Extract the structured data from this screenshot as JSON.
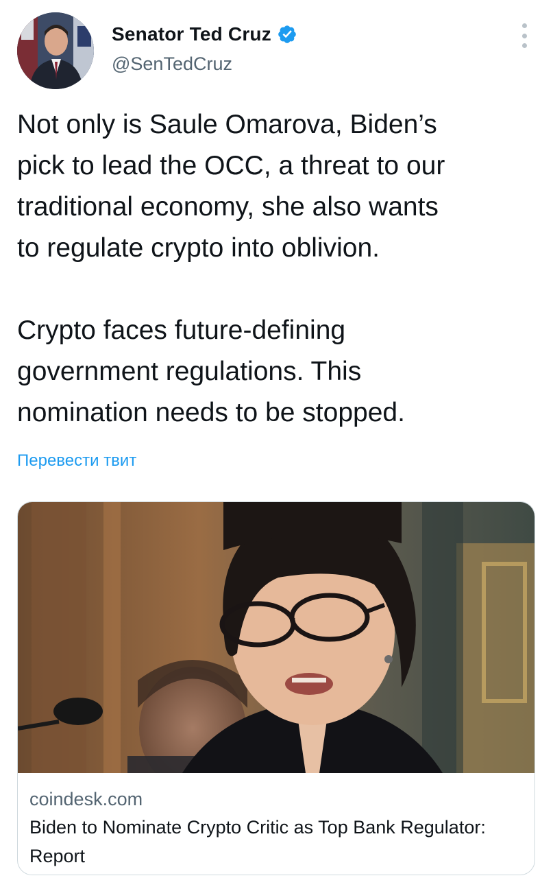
{
  "author": {
    "display_name": "Senator Ted Cruz",
    "handle": "@SenTedCruz",
    "verified": true,
    "avatar_icon": "profile-photo"
  },
  "menu": {
    "icon": "more-vertical-icon"
  },
  "tweet": {
    "paragraph_1": "Not only is Saule Omarova, Biden’s\npick to lead the OCC, a threat to our\ntraditional economy, she also wants\nto regulate crypto into oblivion.",
    "paragraph_2": "Crypto faces future-defining\ngovernment regulations. This\nnomination needs to be stopped.",
    "translate_label": "Перевести твит"
  },
  "card": {
    "domain": "coindesk.com",
    "title": "Biden to Nominate Crypto Critic as Top Bank Regulator: Report",
    "image_icon": "article-photo"
  },
  "colors": {
    "link_blue": "#1d9bf0",
    "verified_blue": "#1d9bf0",
    "secondary_text": "#536471",
    "primary_text": "#0f1419",
    "card_border": "#cfd9de"
  }
}
